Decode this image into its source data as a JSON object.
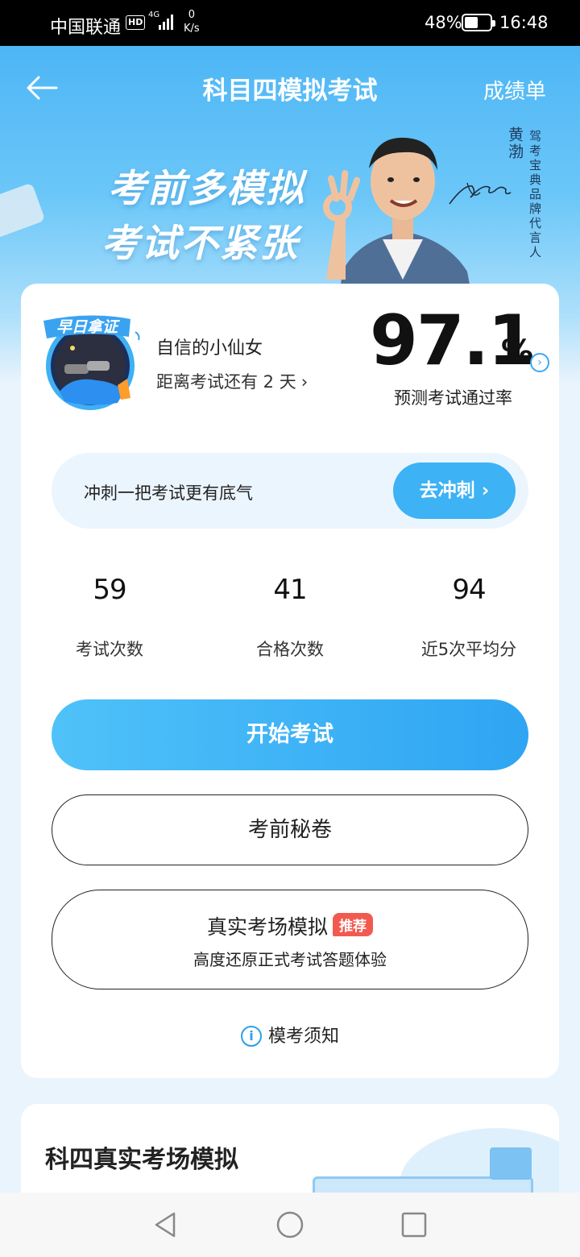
{
  "status_bar": {
    "carrier": "中国联通",
    "hd": "HD",
    "network": "4G",
    "speed_value": "0",
    "speed_unit": "K/s",
    "battery": "48%",
    "battery_level": 0.48,
    "time": "16:48"
  },
  "nav": {
    "title": "科目四模拟考试",
    "right_link": "成绩单"
  },
  "banner": {
    "slogan_line1": "考前多模拟",
    "slogan_line2": "考试不紧张",
    "endorser_name": "黄渤",
    "endorser_role": "驾考宝典品牌代言人"
  },
  "profile": {
    "badge_text": "早日拿证",
    "username": "自信的小仙女",
    "countdown": "距离考试还有 2 天"
  },
  "pass_rate": {
    "value": "97.1",
    "unit": "%",
    "label": "预测考试通过率"
  },
  "sprint": {
    "text": "冲刺一把考试更有底气",
    "button": "去冲刺"
  },
  "stats": [
    {
      "value": "59",
      "label": "考试次数"
    },
    {
      "value": "41",
      "label": "合格次数"
    },
    {
      "value": "94",
      "label": "近5次平均分"
    }
  ],
  "buttons": {
    "start": "开始考试",
    "secret": "考前秘卷",
    "real_title": "真实考场模拟",
    "real_tag": "推荐",
    "real_sub": "高度还原正式考试答题体验"
  },
  "notice": "模考须知",
  "section2": {
    "title": "科四真实考场模拟"
  },
  "colors": {
    "accent": "#3db2f5",
    "header_bg": "#4db6f5",
    "tag_red": "#f25a50"
  }
}
